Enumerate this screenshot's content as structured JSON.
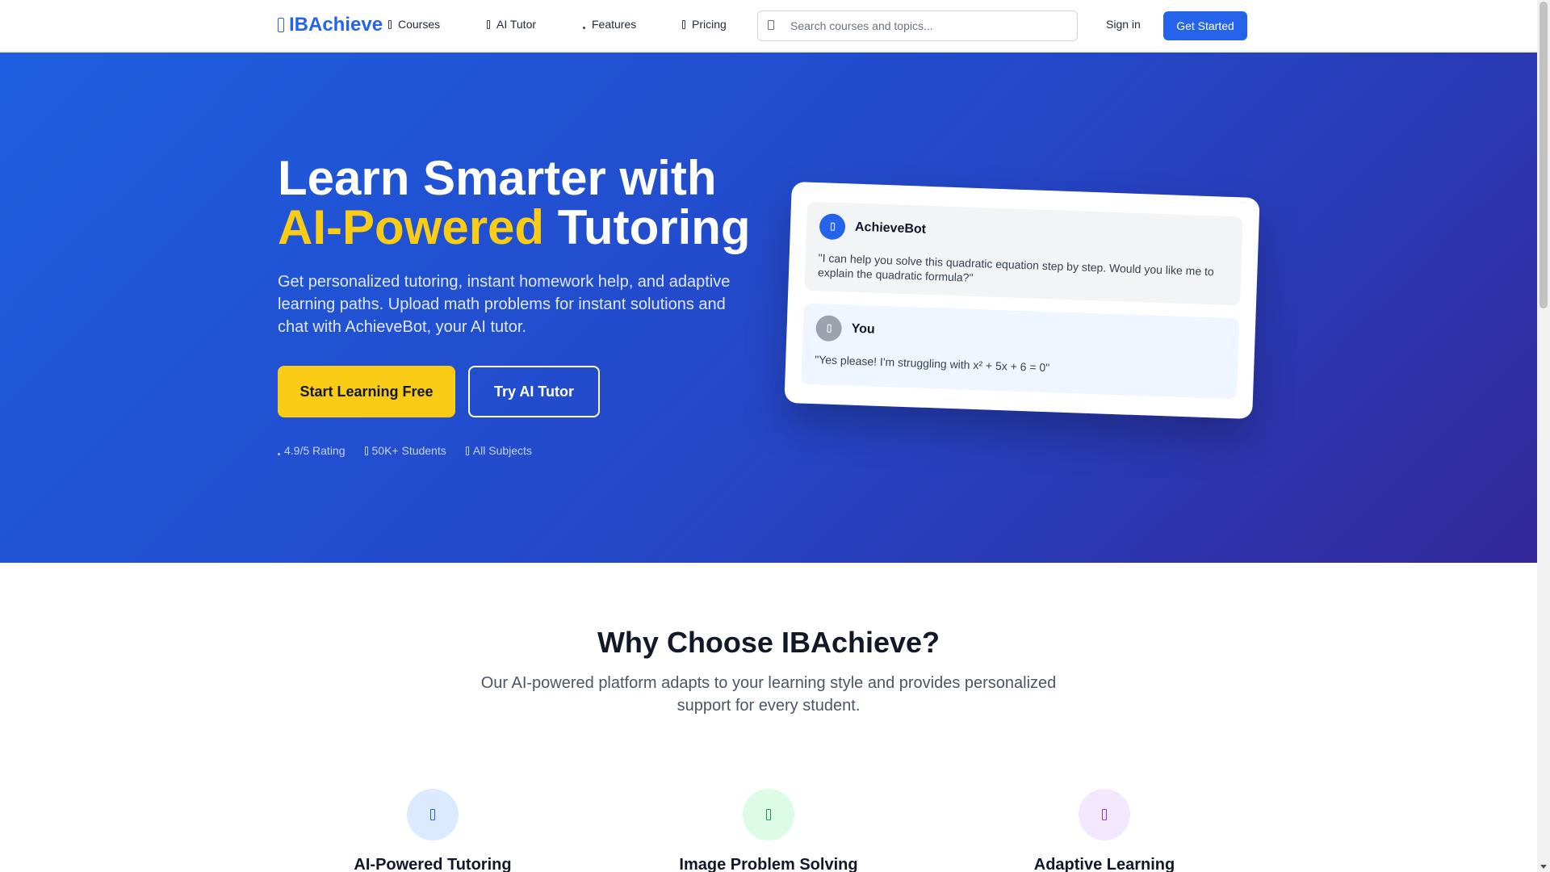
{
  "nav": {
    "logo_text": "IBAchieve",
    "logo_icon": "book-icon",
    "links": [
      {
        "label": "Courses",
        "icon": "book-icon"
      },
      {
        "label": "AI Tutor",
        "icon": "robot-icon"
      },
      {
        "label": "Features",
        "icon": "star-icon"
      },
      {
        "label": "Pricing",
        "icon": "tag-icon"
      }
    ],
    "search_placeholder": "Search courses and topics...",
    "sign_in": "Sign in",
    "get_started": "Get Started",
    "accent_color": "#2563eb"
  },
  "hero": {
    "title_line1": "Learn Smarter with",
    "title_accent": "AI-Powered",
    "title_rest": "Tutoring",
    "subtitle": "Get personalized tutoring, instant homework help, and adaptive learning paths. Upload math problems for instant solutions and chat with AchieveBot, your AI tutor.",
    "cta_primary": "Start Learning Free",
    "cta_secondary": "Try AI Tutor",
    "stats": [
      {
        "label": "4.9/5 Rating",
        "icon": "star-icon"
      },
      {
        "label": "50K+ Students",
        "icon": "users-icon"
      },
      {
        "label": "All Subjects",
        "icon": "book-icon"
      }
    ],
    "accent_color": "#facc15"
  },
  "chat": {
    "bot_name": "AchieveBot",
    "bot_message": "\"I can help you solve this quadratic equation step by step. Would you like me to explain the quadratic formula?\"",
    "user_name": "You",
    "user_message": "\"Yes please! I'm struggling with x² + 5x + 6 = 0\""
  },
  "why": {
    "title": "Why Choose IBAchieve?",
    "subtitle": "Our AI-powered platform adapts to your learning style and provides personalized support for every student.",
    "features": [
      {
        "title": "AI-Powered Tutoring",
        "icon": "robot-icon",
        "color": "#2563eb",
        "bg": "#dbeafe"
      },
      {
        "title": "Image Problem Solving",
        "icon": "camera-icon",
        "color": "#16a34a",
        "bg": "#dcfce7"
      },
      {
        "title": "Adaptive Learning",
        "icon": "brain-icon",
        "color": "#9333ea",
        "bg": "#f3e8ff"
      }
    ]
  }
}
